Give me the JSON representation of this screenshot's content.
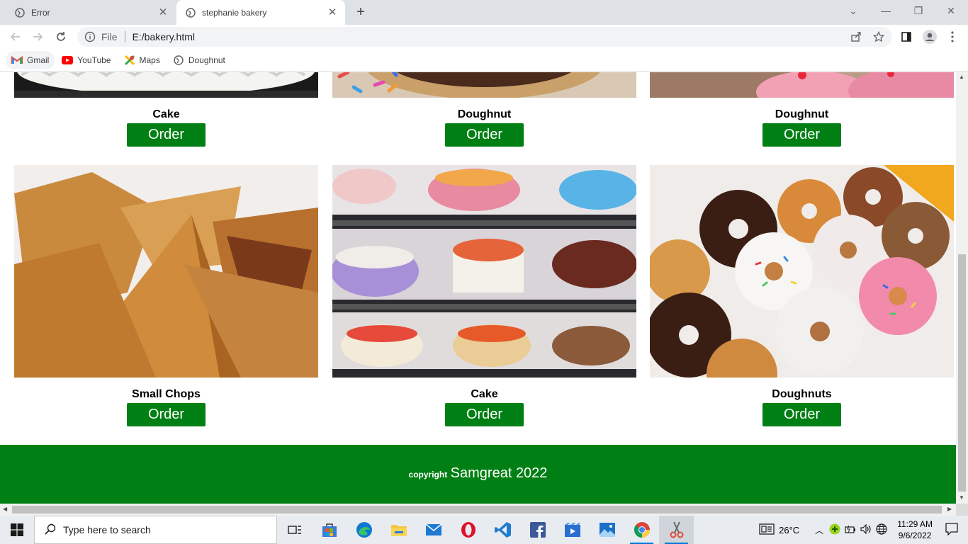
{
  "browser": {
    "tabs": [
      {
        "title": "Error"
      },
      {
        "title": "stephanie bakery"
      }
    ],
    "address": {
      "scheme": "File",
      "url": "E:/bakery.html"
    },
    "bookmarks": [
      {
        "label": "Gmail"
      },
      {
        "label": "YouTube"
      },
      {
        "label": "Maps"
      },
      {
        "label": "Doughnut"
      }
    ]
  },
  "page": {
    "top_row": [
      {
        "name": "Cake",
        "button": "Order"
      },
      {
        "name": "Doughnut",
        "button": "Order"
      },
      {
        "name": "Doughnut",
        "button": "Order"
      }
    ],
    "bottom_row": [
      {
        "name": "Small Chops",
        "button": "Order"
      },
      {
        "name": "Cake",
        "button": "Order"
      },
      {
        "name": "Doughnuts",
        "button": "Order"
      }
    ],
    "footer": {
      "small": "copyright",
      "big": "Samgreat 2022"
    }
  },
  "taskbar": {
    "search_placeholder": "Type here to search",
    "weather": "26°C",
    "time": "11:29 AM",
    "date": "9/6/2022"
  },
  "colors": {
    "brand_green": "#008014"
  }
}
